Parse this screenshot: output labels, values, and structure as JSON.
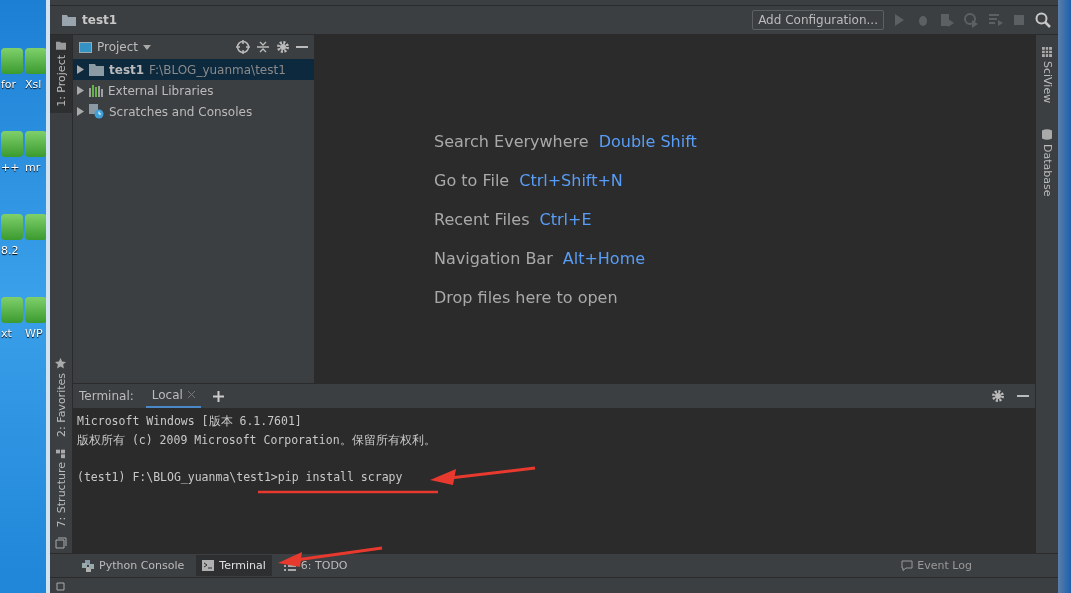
{
  "desktop": {
    "rows": [
      [
        {
          "label": "for"
        },
        {
          "label": "Xsl"
        }
      ],
      [
        {
          "label": "++"
        },
        {
          "label": "mr"
        }
      ],
      [
        {
          "label": "8.2"
        },
        {}
      ],
      [
        {
          "label": "xt"
        },
        {
          "label": "WP"
        }
      ]
    ]
  },
  "navbar": {
    "project": "test1",
    "add_configuration": "Add Configuration..."
  },
  "left_strip": [
    {
      "label": "1: Project",
      "selected": true,
      "kind": "project"
    },
    {
      "label": "2: Favorites",
      "selected": false,
      "kind": "favorites"
    },
    {
      "label": "7: Structure",
      "selected": false,
      "kind": "structure"
    }
  ],
  "project_panel": {
    "title": "Project",
    "items": [
      {
        "label": "test1",
        "path": "F:\\BLOG_yuanma\\test1",
        "selected": true,
        "kind": "folder"
      },
      {
        "label": "External Libraries",
        "selected": false,
        "kind": "libraries"
      },
      {
        "label": "Scratches and Consoles",
        "selected": false,
        "kind": "scratches"
      }
    ]
  },
  "hints": [
    {
      "text": "Search Everywhere",
      "shortcut": "Double Shift"
    },
    {
      "text": "Go to File",
      "shortcut": "Ctrl+Shift+N"
    },
    {
      "text": "Recent Files",
      "shortcut": "Ctrl+E"
    },
    {
      "text": "Navigation Bar",
      "shortcut": "Alt+Home"
    },
    {
      "text": "Drop files here to open"
    }
  ],
  "right_strip": [
    {
      "label": "SciView",
      "kind": "sciview"
    },
    {
      "label": "Database",
      "kind": "database"
    }
  ],
  "terminal": {
    "title": "Terminal:",
    "tabs": [
      {
        "label": "Local",
        "selected": true
      }
    ],
    "lines": [
      {
        "text": "Microsoft Windows [版本 6.1.7601]"
      },
      {
        "text": "版权所有 (c) 2009 Microsoft Corporation。保留所有权利。"
      },
      {
        "text": "(test1) F:\\BLOG_yuanma\\test1>pip install scrapy"
      }
    ]
  },
  "bottom_tabs": [
    {
      "label": "Python Console",
      "selected": false,
      "kind": "python"
    },
    {
      "label": "Terminal",
      "selected": true,
      "kind": "terminal"
    },
    {
      "label": "6: TODO",
      "selected": false,
      "kind": "todo"
    }
  ],
  "status_bar": {
    "event_log": "Event Log"
  }
}
